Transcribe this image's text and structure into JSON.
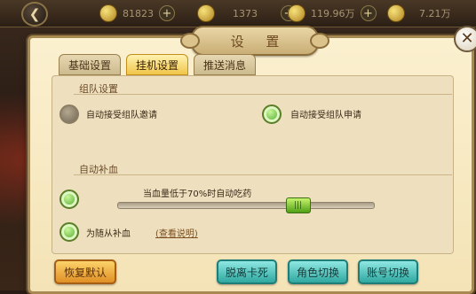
{
  "topbar": {
    "resources": [
      {
        "icon": "gold-ingot-icon",
        "value": "81823"
      },
      {
        "icon": "silver-icon",
        "value": "1373"
      },
      {
        "icon": "copper-coin-icon",
        "value": "119.96万"
      },
      {
        "icon": "gourd-icon",
        "value": "7.21万"
      }
    ]
  },
  "dialog": {
    "title": "设 置",
    "tabs": [
      "基础设置",
      "挂机设置",
      "推送消息"
    ],
    "active_tab": 1,
    "team": {
      "section_title": "组队设置",
      "options": [
        {
          "label": "自动接受组队邀请",
          "checked": false
        },
        {
          "label": "自动接受组队申请",
          "checked": true
        }
      ]
    },
    "heal": {
      "section_title": "自动补血",
      "auto_heal_enabled": true,
      "slider_label": "当血量低于70%时自动吃药",
      "slider_percent": 70,
      "follower_label": "为随从补血",
      "follower_enabled": true,
      "help_link": "(查看说明)"
    },
    "buttons": {
      "reset": "恢复默认",
      "unstuck": "脱离卡死",
      "switch_role": "角色切换",
      "switch_account": "账号切换"
    }
  },
  "colors": {
    "dialog_bg": "#f4e3b6",
    "tab_active": "#f0c64b",
    "radio_on": "#3a9a1b",
    "button_orange": "#e08f24",
    "button_teal": "#2fa8a0"
  }
}
